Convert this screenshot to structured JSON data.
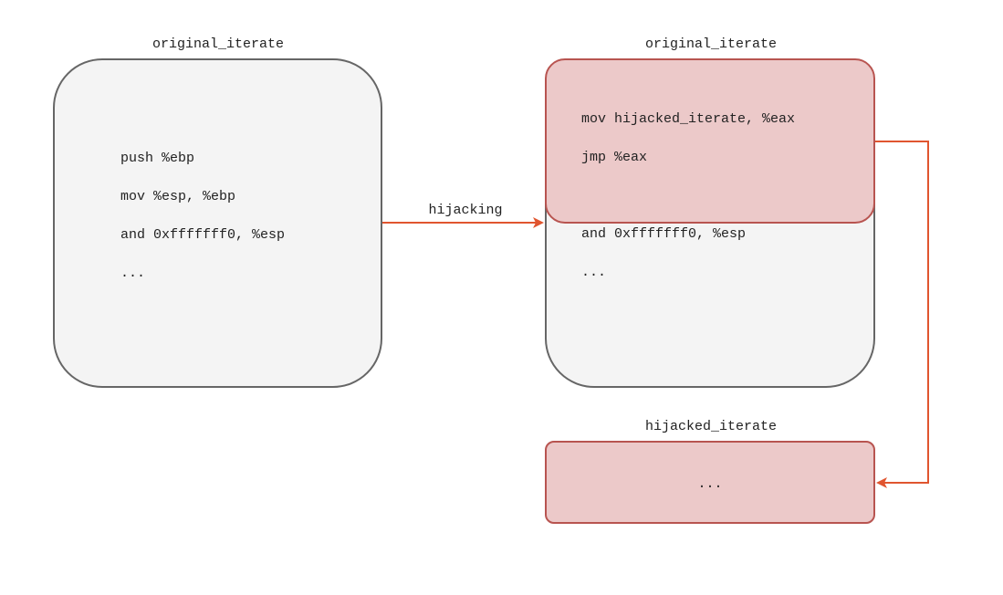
{
  "left_block": {
    "title": "original_iterate",
    "lines": [
      "push %ebp",
      "mov %esp, %ebp",
      "and 0xfffffff0, %esp",
      "..."
    ]
  },
  "arrow": {
    "label": "hijacking",
    "color": "#e0552f"
  },
  "right_block": {
    "title": "original_iterate",
    "patched_lines": [
      "mov hijacked_iterate, %eax",
      "jmp %eax"
    ],
    "remaining_lines": [
      "and 0xfffffff0, %esp",
      "..."
    ]
  },
  "target_block": {
    "title": "hijacked_iterate",
    "body": "..."
  },
  "colors": {
    "normal_fill": "#f4f4f4",
    "normal_stroke": "#666666",
    "highlight_fill": "#ecc9c9",
    "highlight_stroke": "#b85450",
    "arrow": "#e0552f"
  }
}
